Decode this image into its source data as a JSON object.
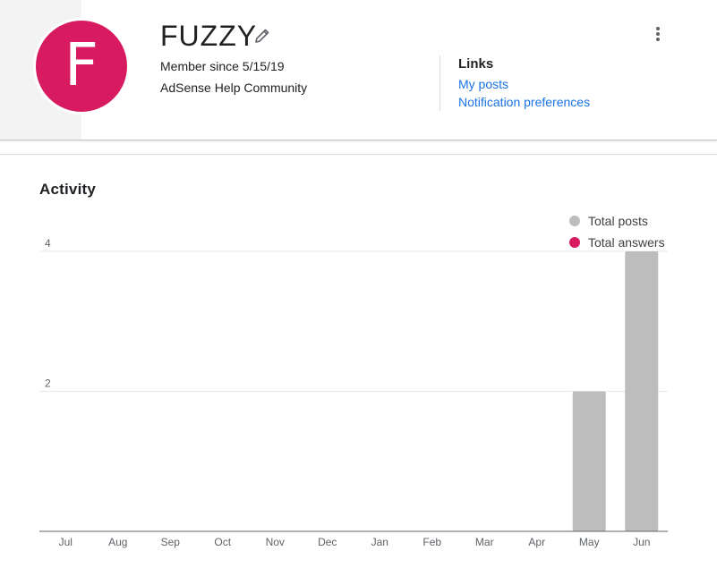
{
  "profile": {
    "avatar_letter": "F",
    "name": "FUZZY",
    "member_since": "Member since 5/15/19",
    "community": "AdSense Help Community",
    "avatar_color": "#d81b60"
  },
  "links": {
    "title": "Links",
    "items": [
      "My posts",
      "Notification preferences"
    ],
    "color": "#1a73e8"
  },
  "activity": {
    "title": "Activity"
  },
  "chart_data": {
    "type": "bar",
    "categories": [
      "Jul",
      "Aug",
      "Sep",
      "Oct",
      "Nov",
      "Dec",
      "Jan",
      "Feb",
      "Mar",
      "Apr",
      "May",
      "Jun"
    ],
    "series": [
      {
        "name": "Total posts",
        "color": "#bdbdbd",
        "values": [
          0,
          0,
          0,
          0,
          0,
          0,
          0,
          0,
          0,
          0,
          2,
          4
        ]
      },
      {
        "name": "Total answers",
        "color": "#d81b60",
        "values": [
          0,
          0,
          0,
          0,
          0,
          0,
          0,
          0,
          0,
          0,
          0,
          0
        ]
      }
    ],
    "yticks": [
      2,
      4
    ],
    "ylim": [
      0,
      4
    ],
    "legend": "top-right",
    "grid": true
  }
}
